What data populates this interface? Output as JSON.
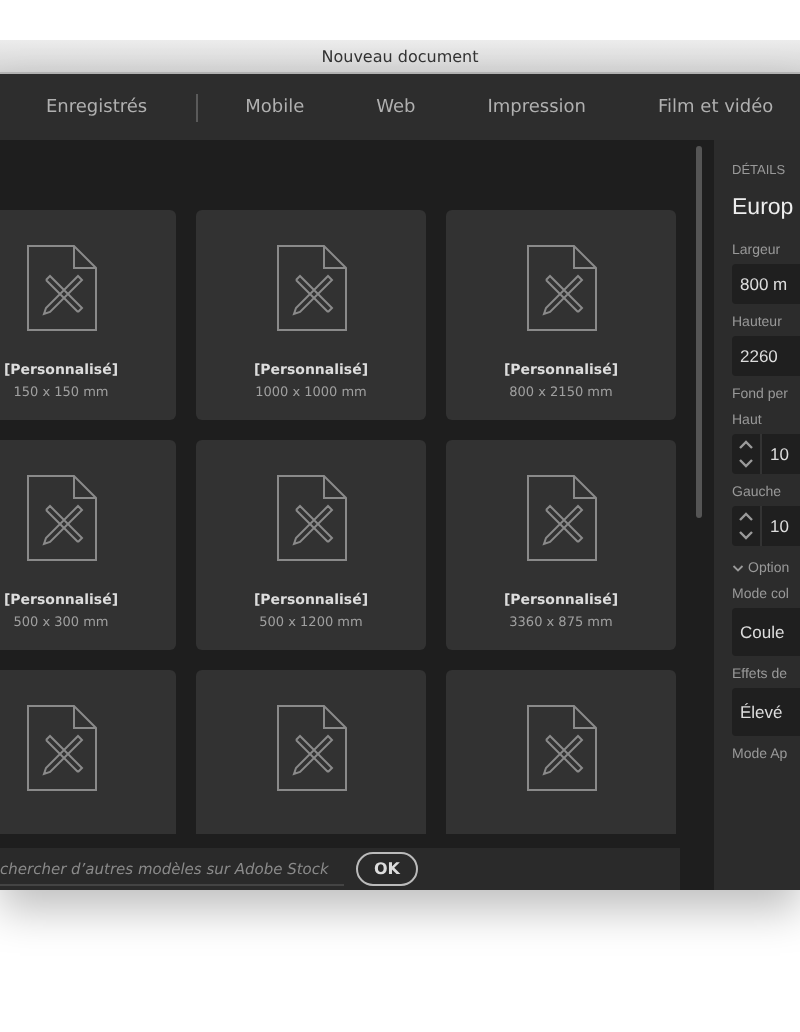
{
  "window": {
    "title": "Nouveau document"
  },
  "tabs": [
    {
      "label": "Enregistrés",
      "selected": false,
      "divider_after": true
    },
    {
      "label": "Mobile",
      "selected": false
    },
    {
      "label": "Web",
      "selected": false
    },
    {
      "label": "Impression",
      "selected": false
    },
    {
      "label": "Film et vidéo",
      "selected": false
    }
  ],
  "templates": [
    {
      "kind": "labeled",
      "name": "[Personnalisé]",
      "size": "150 x 150 mm"
    },
    {
      "kind": "labeled",
      "name": "[Personnalisé]",
      "size": "1000 x 1000 mm"
    },
    {
      "kind": "labeled",
      "name": "[Personnalisé]",
      "size": "800 x 2150 mm"
    },
    {
      "kind": "labeled",
      "name": "[Personnalisé]",
      "size": "500 x 300 mm"
    },
    {
      "kind": "labeled",
      "name": "[Personnalisé]",
      "size": "500 x 1200 mm"
    },
    {
      "kind": "labeled",
      "name": "[Personnalisé]",
      "size": "3360 x 875 mm"
    },
    {
      "kind": "unlabeled"
    },
    {
      "kind": "unlabeled"
    },
    {
      "kind": "unlabeled"
    }
  ],
  "stock_search": {
    "placeholder": "chercher d’autres modèles sur Adobe Stock",
    "button": "OK"
  },
  "details": {
    "heading": "DÉTAILS",
    "preset_name": "Europ",
    "rows": [
      {
        "kind": "field",
        "label": "Largeur",
        "value": "800 m"
      },
      {
        "kind": "field",
        "label": "Hauteur",
        "value": "2260"
      },
      {
        "kind": "caption",
        "label": "Fond per"
      },
      {
        "kind": "stepper",
        "label": "Haut",
        "value": "10"
      },
      {
        "kind": "stepper",
        "label": "Gauche",
        "value": "10"
      },
      {
        "kind": "section",
        "label": "Option",
        "expanded": true
      },
      {
        "kind": "dropdown",
        "label": "Mode col",
        "value": "Coule"
      },
      {
        "kind": "dropdown",
        "label": "Effets de",
        "value": "Élevé"
      },
      {
        "kind": "caption",
        "label": "Mode Ap"
      }
    ]
  }
}
